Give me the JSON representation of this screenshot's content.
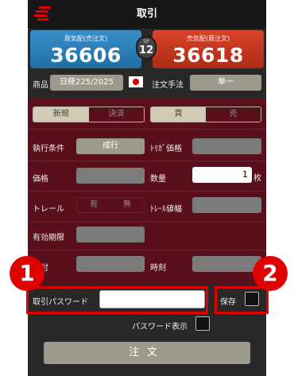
{
  "header": {
    "title": "取引"
  },
  "quotes": {
    "bid": {
      "label": "買気配(売注文)",
      "value": "36606"
    },
    "ask": {
      "label": "売気配(買注文)",
      "value": "36618"
    },
    "spread": {
      "label": "SP",
      "value": "12"
    }
  },
  "product": {
    "label": "商品",
    "value": "日経225/2025",
    "order_method_label": "注文手法",
    "order_method_value": "単一"
  },
  "form": {
    "order_type": {
      "new": "新規",
      "settle": "決済"
    },
    "side": {
      "buy": "買",
      "sell": "売"
    },
    "exec_condition_label": "執行条件",
    "exec_condition_value": "成行",
    "trigger_price_label": "ﾄﾘｶﾞ価格",
    "price_label": "価格",
    "quantity_label": "数量",
    "quantity_value": "1",
    "quantity_unit": "枚",
    "trail_label": "トレール",
    "trail_yes": "有",
    "trail_no": "無",
    "trail_width_label": "ﾄﾚｰﾙ値幅",
    "expiry_label": "有効期限",
    "date_label": "日付",
    "time_label": "時刻"
  },
  "password": {
    "label": "取引パスワード",
    "save_label": "保存",
    "show_label": "パスワード表示"
  },
  "order_button": {
    "label": "注文"
  },
  "callouts": {
    "one": "1",
    "two": "2"
  },
  "colors": {
    "bid": "#1f6fa6",
    "ask": "#b02b14",
    "panel": "#5a0f1c",
    "highlight": "#e00000"
  }
}
